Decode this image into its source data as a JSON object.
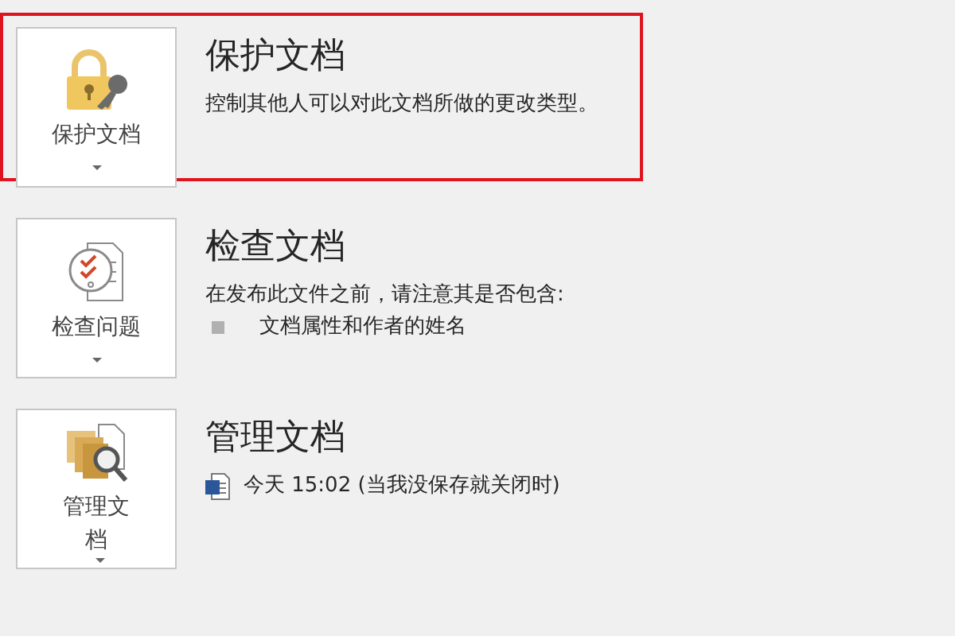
{
  "sections": [
    {
      "kind": "protect",
      "highlighted": true,
      "button_label": "保护文档",
      "title": "保护文档",
      "description": "控制其他人可以对此文档所做的更改类型。"
    },
    {
      "kind": "inspect",
      "highlighted": false,
      "button_label": "检查问题",
      "title": "检查文档",
      "description": "在发布此文件之前，请注意其是否包含:",
      "bullets": [
        "文档属性和作者的姓名"
      ]
    },
    {
      "kind": "manage",
      "highlighted": false,
      "button_label": "管理文档",
      "title": "管理文档",
      "versions": [
        "今天 15:02 (当我没保存就关闭时)"
      ]
    }
  ]
}
